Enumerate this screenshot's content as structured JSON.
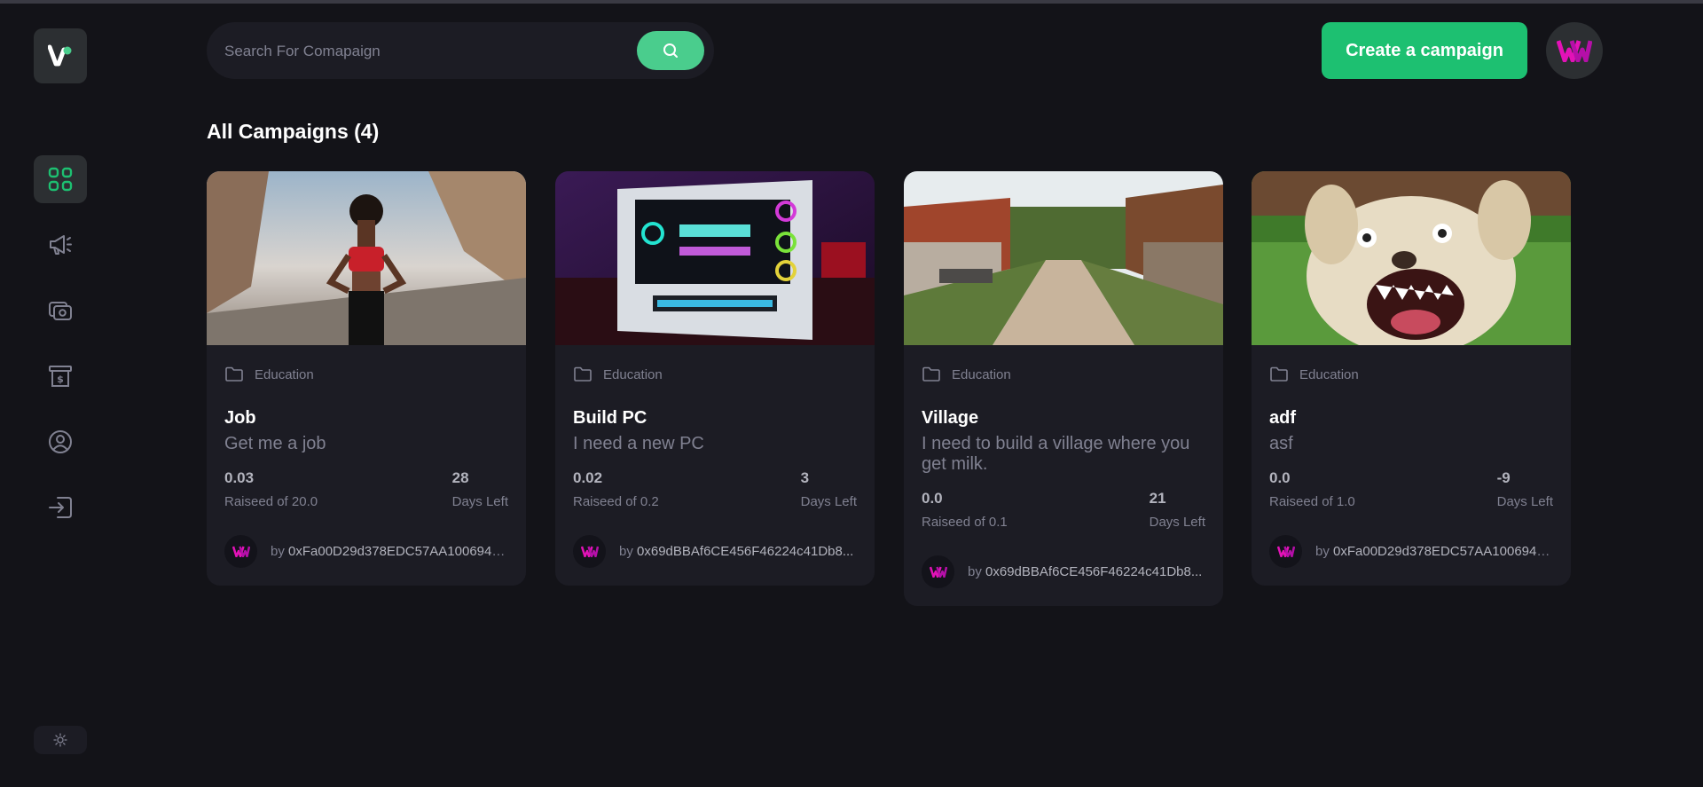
{
  "header": {
    "search_placeholder": "Search For Comapaign",
    "create_button_label": "Create a campaign"
  },
  "main": {
    "heading": "All Campaigns (4)"
  },
  "colors": {
    "background": "#131318",
    "card": "#1c1c24",
    "accent": "#1dc071",
    "search_button": "#4acd8d",
    "muted_text": "#808191"
  },
  "sidebar": {
    "items": [
      {
        "icon": "dashboard-icon",
        "active": true
      },
      {
        "icon": "campaign-megaphone-icon",
        "active": false
      },
      {
        "icon": "payment-icon",
        "active": false
      },
      {
        "icon": "withdraw-icon",
        "active": false
      },
      {
        "icon": "profile-icon",
        "active": false
      },
      {
        "icon": "logout-icon",
        "active": false
      }
    ],
    "theme_toggle_icon": "sun-icon"
  },
  "campaigns": [
    {
      "category": "Education",
      "title": "Job",
      "description": "Get me a job",
      "raised": "0.03",
      "raised_label": "Raiseed of 20.0",
      "days": "28",
      "days_label": "Days Left",
      "by": "by",
      "owner": "0xFa00D29d378EDC57AA1006946...",
      "image": "woman-athlete-photo"
    },
    {
      "category": "Education",
      "title": "Build PC",
      "description": "I need a new PC",
      "raised": "0.02",
      "raised_label": "Raiseed of 0.2",
      "days": "3",
      "days_label": "Days Left",
      "by": "by",
      "owner": "0x69dBBAf6CE456F46224c41Db8...",
      "image": "gaming-pc-photo"
    },
    {
      "category": "Education",
      "title": "Village",
      "description": "I need to build a village where you get milk.",
      "raised": "0.0",
      "raised_label": "Raiseed of 0.1",
      "days": "21",
      "days_label": "Days Left",
      "by": "by",
      "owner": "0x69dBBAf6CE456F46224c41Db8...",
      "image": "village-street-photo"
    },
    {
      "category": "Education",
      "title": "adf",
      "description": "asf",
      "raised": "0.0",
      "raised_label": "Raiseed of 1.0",
      "days": "-9",
      "days_label": "Days Left",
      "by": "by",
      "owner": "0xFa00D29d378EDC57AA1006946...",
      "image": "dog-photo"
    }
  ]
}
